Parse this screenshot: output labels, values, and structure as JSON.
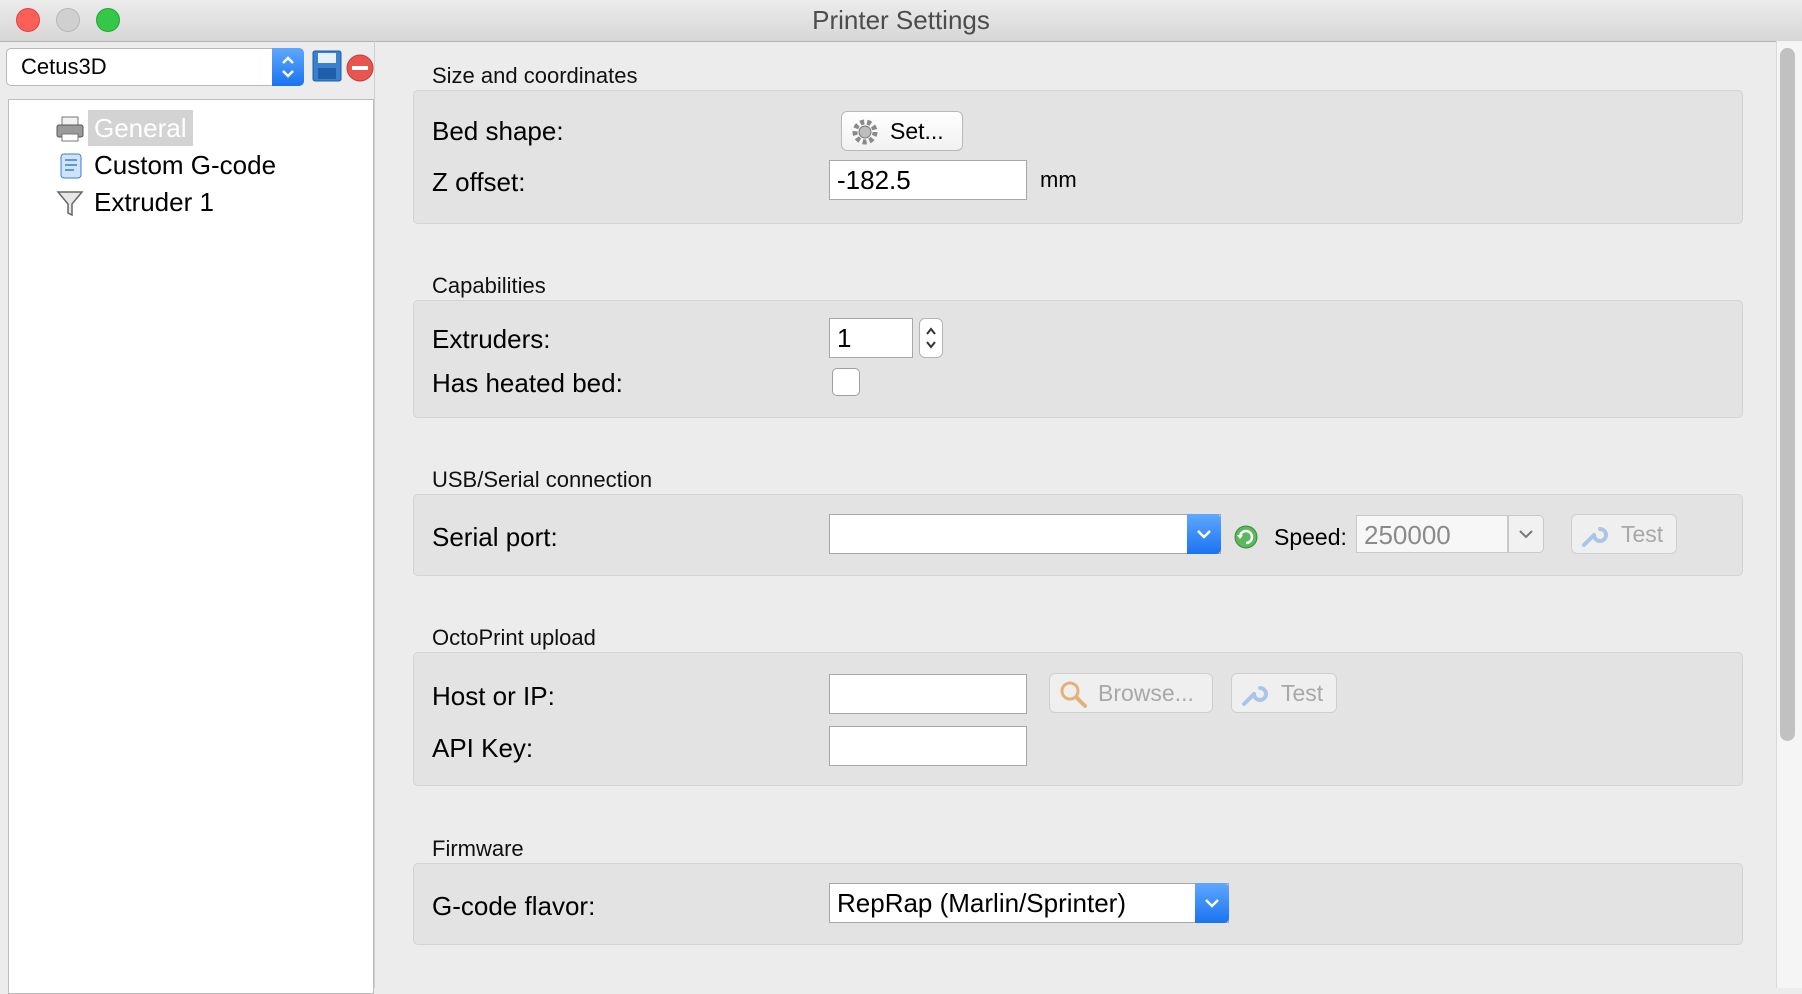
{
  "window": {
    "title": "Printer Settings"
  },
  "preset": {
    "selected": "Cetus3D"
  },
  "tree": {
    "items": [
      {
        "label": "General",
        "icon": "printer-icon"
      },
      {
        "label": "Custom G-code",
        "icon": "script-icon"
      },
      {
        "label": "Extruder 1",
        "icon": "funnel-icon"
      }
    ]
  },
  "size": {
    "title": "Size and coordinates",
    "bed_shape_label": "Bed shape:",
    "set_button": "Set...",
    "z_offset_label": "Z offset:",
    "z_offset_value": "-182.5",
    "z_offset_unit": "mm"
  },
  "capabilities": {
    "title": "Capabilities",
    "extruders_label": "Extruders:",
    "extruders_value": "1",
    "heated_bed_label": "Has heated bed:",
    "heated_bed_checked": false
  },
  "serial": {
    "title": "USB/Serial connection",
    "port_label": "Serial port:",
    "port_value": "",
    "speed_label": "Speed:",
    "speed_value": "250000",
    "test_button": "Test"
  },
  "octoprint": {
    "title": "OctoPrint upload",
    "host_label": "Host or IP:",
    "host_value": "",
    "browse_button": "Browse...",
    "test_button": "Test",
    "api_label": "API Key:",
    "api_value": ""
  },
  "firmware": {
    "title": "Firmware",
    "flavor_label": "G-code flavor:",
    "flavor_value": "RepRap (Marlin/Sprinter)"
  }
}
